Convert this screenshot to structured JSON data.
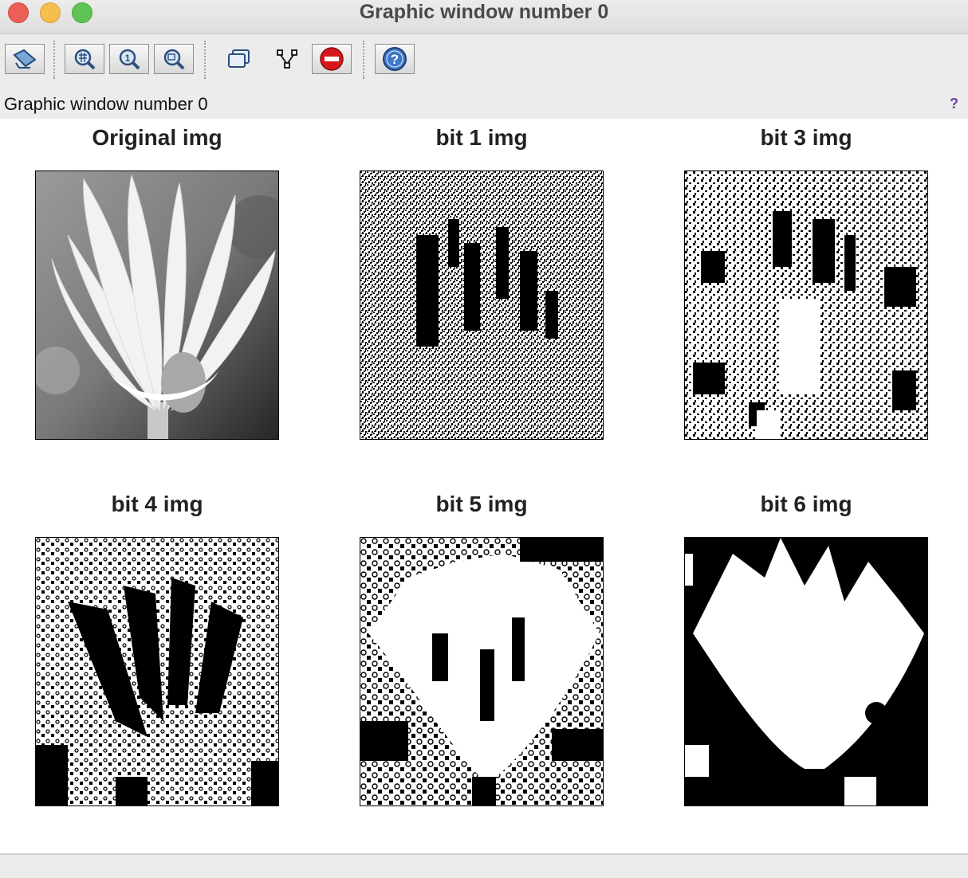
{
  "window": {
    "title": "Graphic window number 0",
    "controls": {
      "close_color": "#ec5f57",
      "minimize_color": "#f5be4f",
      "maximize_color": "#5fc454"
    }
  },
  "toolbar": {
    "buttons": [
      {
        "icon": "rotate-axes-icon"
      },
      {
        "icon": "zoom-icon"
      },
      {
        "icon": "zoom-reset-icon"
      },
      {
        "icon": "zoom-area-icon"
      },
      {
        "icon": "datatip-icon"
      },
      {
        "icon": "editor-icon"
      },
      {
        "icon": "stop-icon"
      },
      {
        "icon": "help-icon"
      }
    ]
  },
  "infobar": {
    "text": "Graphic window number 0",
    "help_glyph": "?"
  },
  "panels": [
    {
      "title": "Original img",
      "kind": "grayscale"
    },
    {
      "title": "bit 1 img",
      "kind": "bitplane"
    },
    {
      "title": "bit 3 img",
      "kind": "bitplane"
    },
    {
      "title": "bit 4 img",
      "kind": "bitplane"
    },
    {
      "title": "bit 5 img",
      "kind": "bitplane"
    },
    {
      "title": "bit 6 img",
      "kind": "bitplane"
    }
  ]
}
